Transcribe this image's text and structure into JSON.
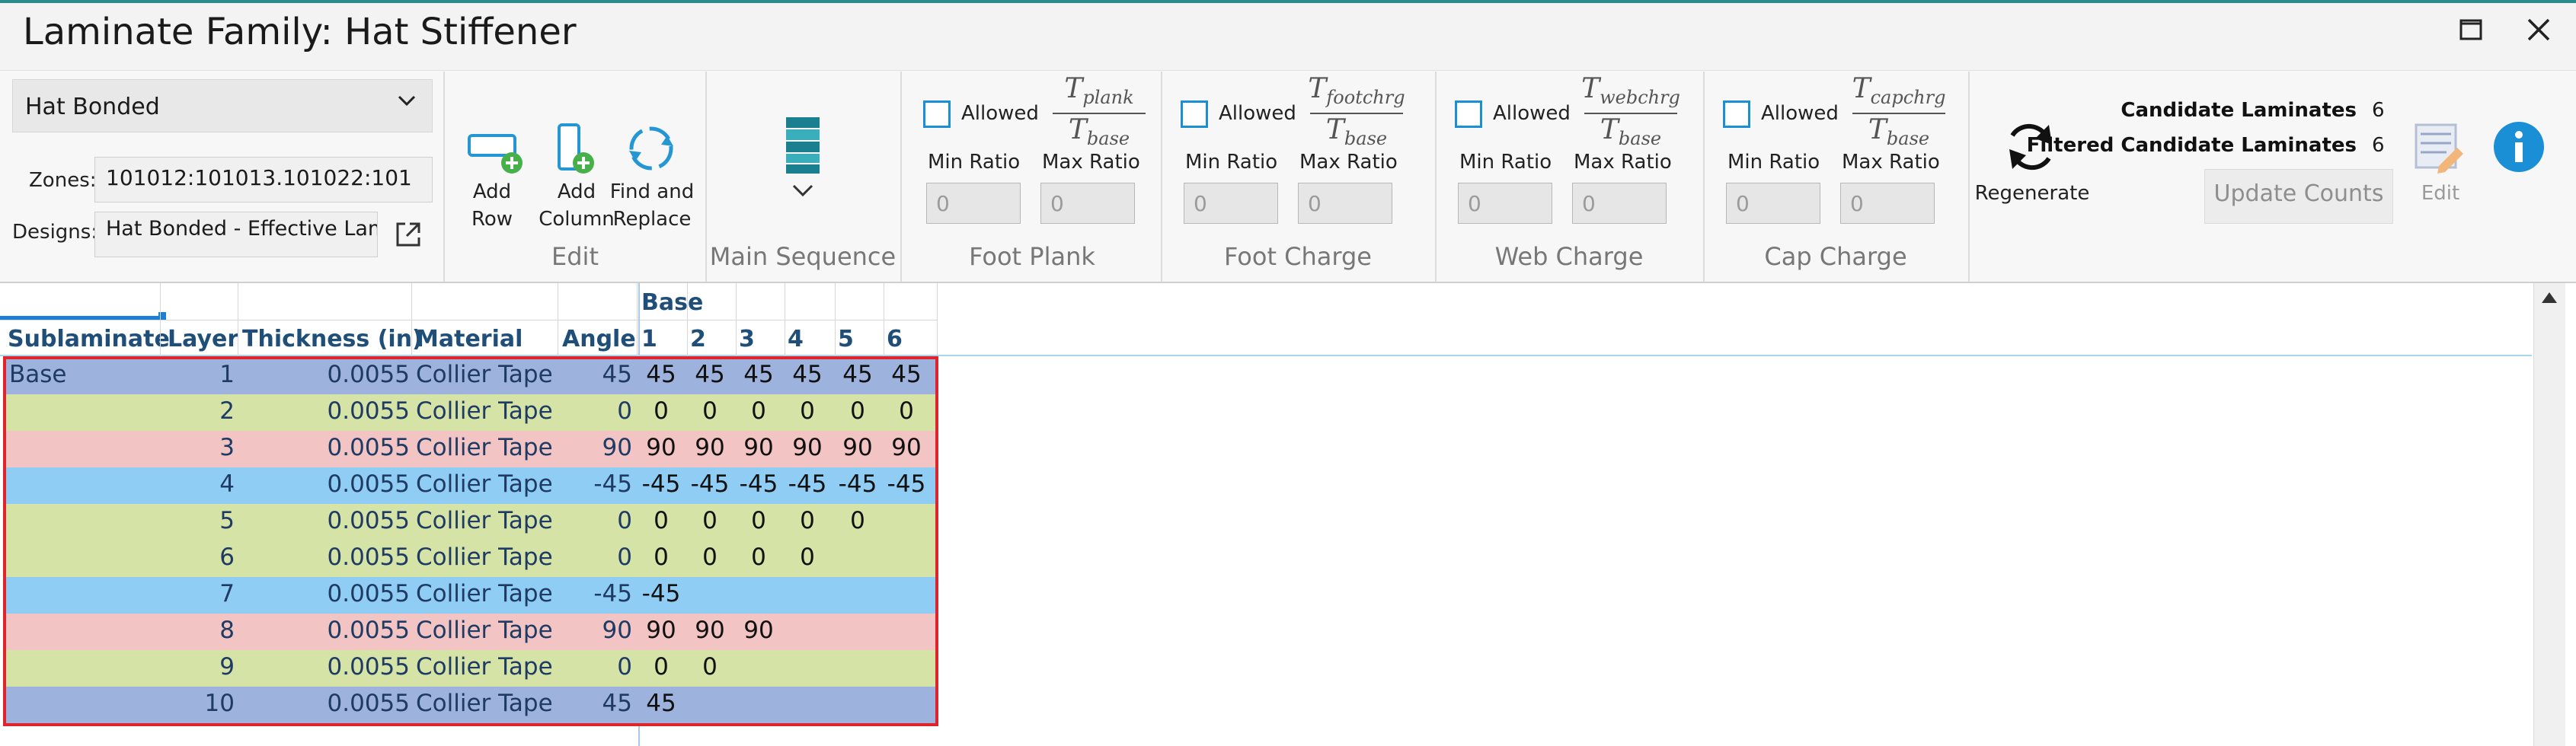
{
  "window": {
    "title": "Laminate Family: Hat Stiffener",
    "maximize_icon": "maximize-icon",
    "close_icon": "close-icon"
  },
  "ribbon": {
    "family_select": {
      "value": "Hat Bonded"
    },
    "zones": {
      "label": "Zones:",
      "value": "101012:101013.101022:101"
    },
    "designs": {
      "label": "Designs:",
      "value": "Hat  Bonded  -  Effective  Laminate"
    },
    "edit_group": {
      "label": "Edit",
      "add_row": [
        "Add",
        "Row"
      ],
      "add_column": [
        "Add",
        "Column"
      ],
      "find_replace": [
        "Find and",
        "Replace"
      ]
    },
    "main_sequence": {
      "label": "Main Sequence"
    },
    "ratio_groups": [
      {
        "label": "Foot Plank",
        "allowed": "Allowed",
        "num": "T",
        "num_sub": "plank",
        "den": "T",
        "den_sub": "base",
        "min_label": "Min Ratio",
        "max_label": "Max Ratio",
        "min_value": "0",
        "max_value": "0"
      },
      {
        "label": "Foot Charge",
        "allowed": "Allowed",
        "num": "T",
        "num_sub": "footchrg",
        "den": "T",
        "den_sub": "base",
        "min_label": "Min Ratio",
        "max_label": "Max Ratio",
        "min_value": "0",
        "max_value": "0"
      },
      {
        "label": "Web Charge",
        "allowed": "Allowed",
        "num": "T",
        "num_sub": "webchrg",
        "den": "T",
        "den_sub": "base",
        "min_label": "Min Ratio",
        "max_label": "Max Ratio",
        "min_value": "0",
        "max_value": "0"
      },
      {
        "label": "Cap Charge",
        "allowed": "Allowed",
        "num": "T",
        "num_sub": "capchrg",
        "den": "T",
        "den_sub": "base",
        "min_label": "Min Ratio",
        "max_label": "Max Ratio",
        "min_value": "0",
        "max_value": "0"
      }
    ],
    "regenerate": {
      "label": "Regenerate"
    },
    "counts": {
      "candidate_label": "Candidate Laminates",
      "candidate_value": "6",
      "filtered_label": "Filtered Candidate Laminates",
      "filtered_value": "6",
      "update_label": "Update Counts"
    },
    "edit_button": {
      "label": "Edit"
    }
  },
  "grid": {
    "group_header": "Base",
    "columns": [
      "Sublaminate",
      "Layer",
      "Thickness (in)",
      "Material",
      "Angle",
      "1",
      "2",
      "3",
      "4",
      "5",
      "6"
    ],
    "rows": [
      {
        "sublaminate": "Base",
        "layer": "1",
        "thickness": "0.0055",
        "material": "Collier Tape",
        "angle": "45",
        "values": [
          "45",
          "45",
          "45",
          "45",
          "45",
          "45"
        ],
        "color": "#9db3dd"
      },
      {
        "sublaminate": "",
        "layer": "2",
        "thickness": "0.0055",
        "material": "Collier Tape",
        "angle": "0",
        "values": [
          "0",
          "0",
          "0",
          "0",
          "0",
          "0"
        ],
        "color": "#d5e4a6"
      },
      {
        "sublaminate": "",
        "layer": "3",
        "thickness": "0.0055",
        "material": "Collier Tape",
        "angle": "90",
        "values": [
          "90",
          "90",
          "90",
          "90",
          "90",
          "90"
        ],
        "color": "#f2c4c4"
      },
      {
        "sublaminate": "",
        "layer": "4",
        "thickness": "0.0055",
        "material": "Collier Tape",
        "angle": "-45",
        "values": [
          "-45",
          "-45",
          "-45",
          "-45",
          "-45",
          "-45"
        ],
        "color": "#8fcdf4"
      },
      {
        "sublaminate": "",
        "layer": "5",
        "thickness": "0.0055",
        "material": "Collier Tape",
        "angle": "0",
        "values": [
          "0",
          "0",
          "0",
          "0",
          "0",
          ""
        ],
        "color": "#d5e4a6"
      },
      {
        "sublaminate": "",
        "layer": "6",
        "thickness": "0.0055",
        "material": "Collier Tape",
        "angle": "0",
        "values": [
          "0",
          "0",
          "0",
          "0",
          "",
          ""
        ],
        "color": "#d5e4a6"
      },
      {
        "sublaminate": "",
        "layer": "7",
        "thickness": "0.0055",
        "material": "Collier Tape",
        "angle": "-45",
        "values": [
          "-45",
          "",
          "",
          "",
          "",
          ""
        ],
        "color": "#8fcdf4"
      },
      {
        "sublaminate": "",
        "layer": "8",
        "thickness": "0.0055",
        "material": "Collier Tape",
        "angle": "90",
        "values": [
          "90",
          "90",
          "90",
          "",
          "",
          ""
        ],
        "color": "#f2c4c4"
      },
      {
        "sublaminate": "",
        "layer": "9",
        "thickness": "0.0055",
        "material": "Collier Tape",
        "angle": "0",
        "values": [
          "0",
          "0",
          "",
          "",
          "",
          ""
        ],
        "color": "#d5e4a6"
      },
      {
        "sublaminate": "",
        "layer": "10",
        "thickness": "0.0055",
        "material": "Collier Tape",
        "angle": "45",
        "values": [
          "45",
          "",
          "",
          "",
          "",
          ""
        ],
        "color": "#9db3dd"
      }
    ]
  },
  "colors": {
    "selection_border": "#e0242b",
    "header_text": "#1f4e79",
    "accent": "#1b8fd6"
  }
}
